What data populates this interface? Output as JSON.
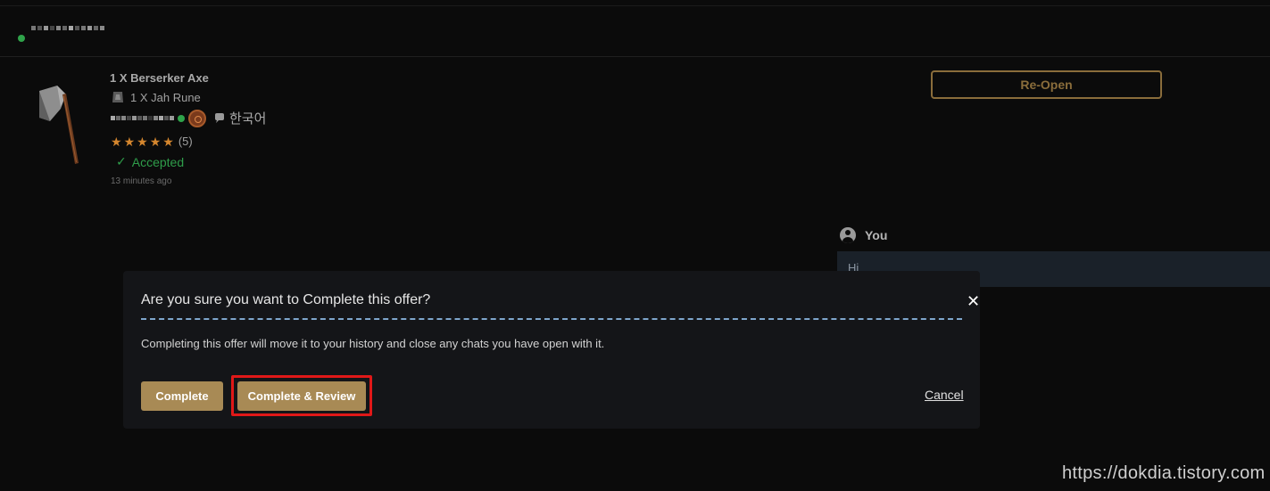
{
  "header": {
    "username_label": "(obscured username)"
  },
  "offer": {
    "title": "1 X Berserker Axe",
    "price": "1 X Jah Rune",
    "language": "한국어",
    "rating_count": "(5)",
    "rating_stars": 5,
    "status": "Accepted",
    "time_ago": "13 minutes ago",
    "reopen_label": "Re-Open"
  },
  "chat": {
    "sender": "You",
    "message": "Hi"
  },
  "modal": {
    "title": "Are you sure you want to Complete this offer?",
    "message": "Completing this offer will move it to your history and close any chats you have open with it.",
    "complete_label": "Complete",
    "complete_review_label": "Complete & Review",
    "cancel_label": "Cancel",
    "close_glyph": "✕"
  },
  "watermark": "https://dokdia.tistory.com",
  "colors": {
    "accent": "#a88a55",
    "highlight": "#e01818",
    "online": "#2fa34a",
    "star": "#d4862e"
  }
}
